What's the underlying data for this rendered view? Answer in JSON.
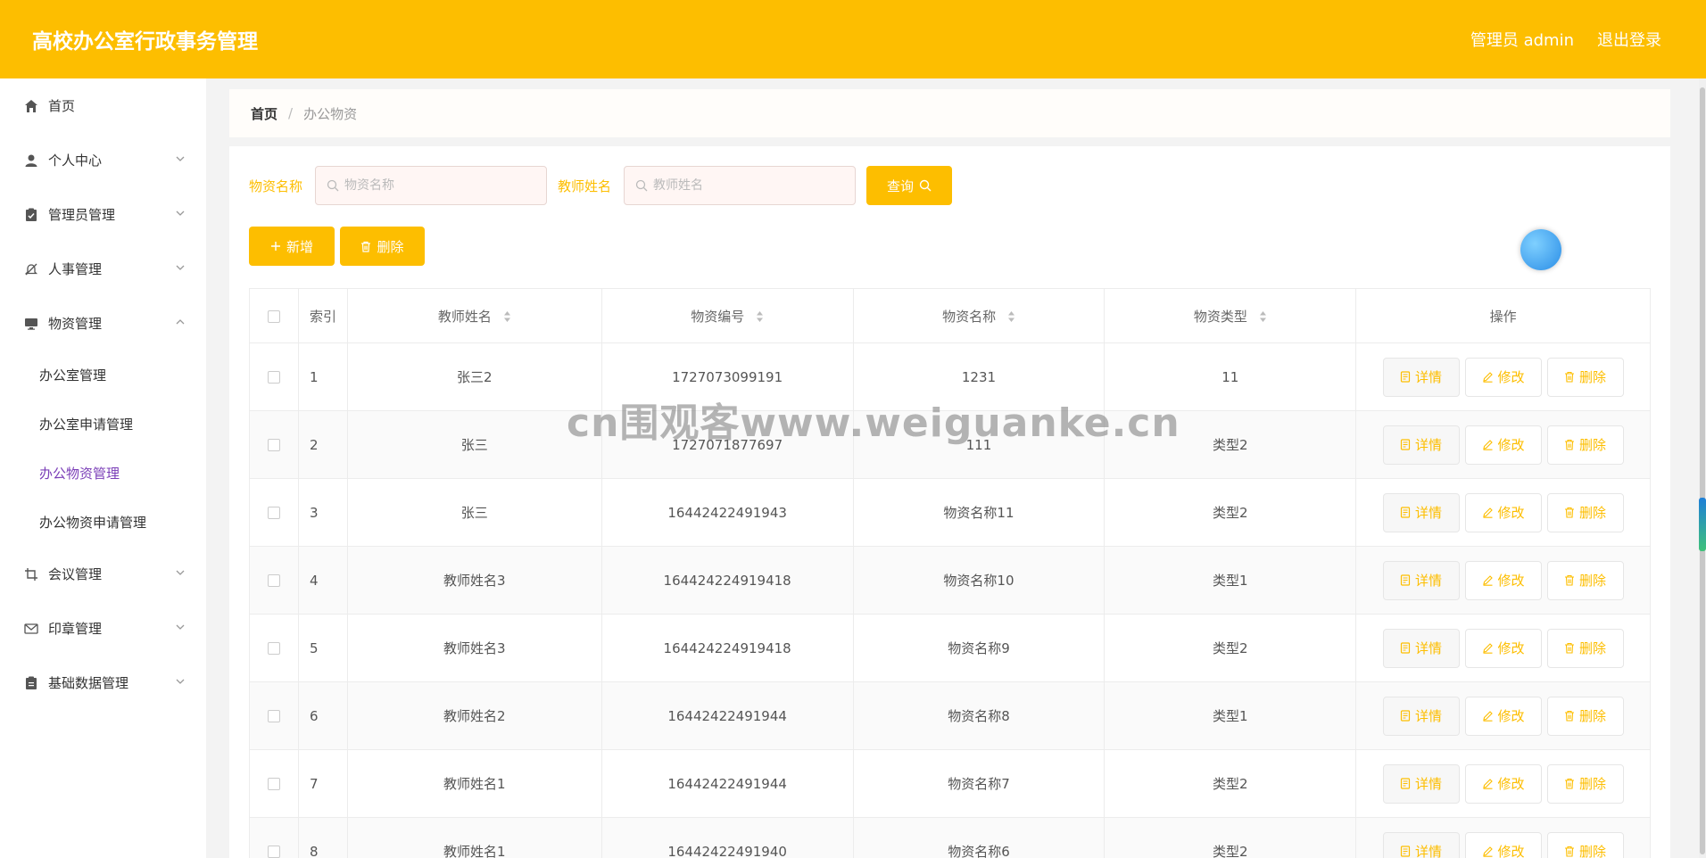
{
  "header": {
    "title": "高校办公室行政事务管理",
    "user_label": "管理员 admin",
    "logout_label": "退出登录"
  },
  "sidebar": {
    "items": [
      {
        "label": "首页",
        "icon": "home-icon"
      },
      {
        "label": "个人中心",
        "icon": "user-icon"
      },
      {
        "label": "管理员管理",
        "icon": "clipboard-check-icon"
      },
      {
        "label": "人事管理",
        "icon": "bell-off-icon"
      },
      {
        "label": "物资管理",
        "icon": "monitor-icon"
      },
      {
        "label": "会议管理",
        "icon": "crop-icon"
      },
      {
        "label": "印章管理",
        "icon": "mail-icon"
      },
      {
        "label": "基础数据管理",
        "icon": "clipboard-icon"
      }
    ],
    "sub_items": [
      {
        "label": "办公室管理"
      },
      {
        "label": "办公室申请管理"
      },
      {
        "label": "办公物资管理"
      },
      {
        "label": "办公物资申请管理"
      }
    ],
    "active_sub": "办公物资管理"
  },
  "breadcrumb": {
    "home": "首页",
    "separator": "/",
    "current": "办公物资"
  },
  "search": {
    "name_label": "物资名称",
    "name_placeholder": "物资名称",
    "teacher_label": "教师姓名",
    "teacher_placeholder": "教师姓名",
    "query_label": "查询"
  },
  "actions": {
    "add_label": "新增",
    "delete_label": "删除"
  },
  "table": {
    "headers": {
      "index": "索引",
      "teacher": "教师姓名",
      "code": "物资编号",
      "name": "物资名称",
      "type": "物资类型",
      "op": "操作"
    },
    "row_actions": {
      "detail": "详情",
      "edit": "修改",
      "delete": "删除"
    },
    "rows": [
      {
        "index": "1",
        "teacher": "张三2",
        "code": "1727073099191",
        "name": "1231",
        "type": "11"
      },
      {
        "index": "2",
        "teacher": "张三",
        "code": "1727071877697",
        "name": "111",
        "type": "类型2"
      },
      {
        "index": "3",
        "teacher": "张三",
        "code": "16442422491943",
        "name": "物资名称11",
        "type": "类型2"
      },
      {
        "index": "4",
        "teacher": "教师姓名3",
        "code": "164424224919418",
        "name": "物资名称10",
        "type": "类型1"
      },
      {
        "index": "5",
        "teacher": "教师姓名3",
        "code": "164424224919418",
        "name": "物资名称9",
        "type": "类型2"
      },
      {
        "index": "6",
        "teacher": "教师姓名2",
        "code": "16442422491944",
        "name": "物资名称8",
        "type": "类型1"
      },
      {
        "index": "7",
        "teacher": "教师姓名1",
        "code": "16442422491944",
        "name": "物资名称7",
        "type": "类型2"
      },
      {
        "index": "8",
        "teacher": "教师姓名1",
        "code": "16442422491940",
        "name": "物资名称6",
        "type": "类型2"
      }
    ]
  },
  "watermark": "cn围观客www.weiguanke.cn",
  "colors": {
    "accent": "#fdbe00",
    "active_menu": "#7b3fb8"
  }
}
